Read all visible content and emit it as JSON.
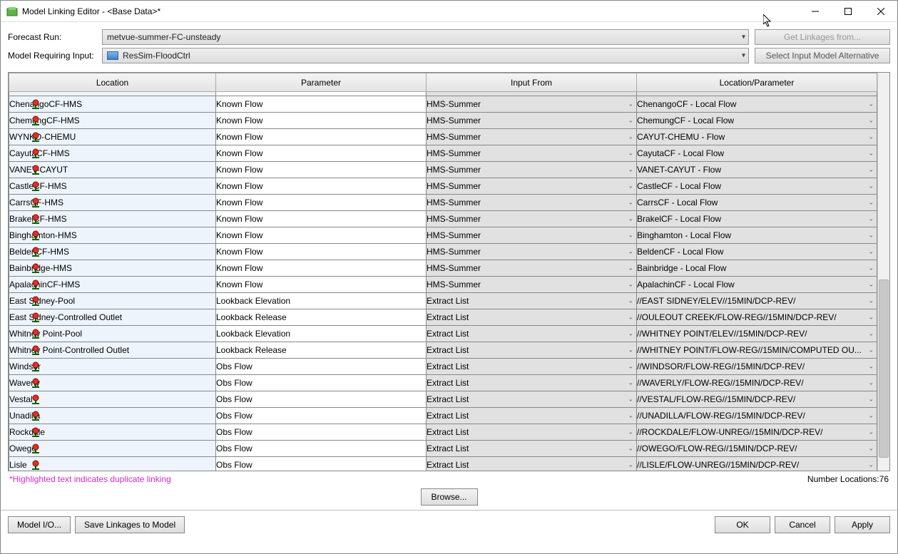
{
  "window": {
    "title": "Model Linking Editor - <Base Data>*"
  },
  "top": {
    "forecast_label": "Forecast Run:",
    "forecast_value": "metvue-summer-FC-unsteady",
    "model_req_label": "Model Requiring Input:",
    "model_req_value": "ResSim-FloodCtrl",
    "get_linkages_btn": "Get Linkages from...",
    "select_alt_btn": "Select Input Model Alternative"
  },
  "columns": {
    "c0": "Location",
    "c1": "Parameter",
    "c2": "Input From",
    "c3": "Location/Parameter"
  },
  "rows": [
    {
      "loc": "ChenangoCF-HMS",
      "param": "Known Flow",
      "input": "HMS-Summer",
      "lp": "ChenangoCF - Local Flow"
    },
    {
      "loc": "ChemungCF-HMS",
      "param": "Known Flow",
      "input": "HMS-Summer",
      "lp": "ChemungCF - Local Flow"
    },
    {
      "loc": "WYNKO-CHEMU",
      "param": "Known Flow",
      "input": "HMS-Summer",
      "lp": "CAYUT-CHEMU - Flow"
    },
    {
      "loc": "CayutaCF-HMS",
      "param": "Known Flow",
      "input": "HMS-Summer",
      "lp": "CayutaCF - Local Flow"
    },
    {
      "loc": "VANET-CAYUT",
      "param": "Known Flow",
      "input": "HMS-Summer",
      "lp": "VANET-CAYUT - Flow"
    },
    {
      "loc": "CastleCF-HMS",
      "param": "Known Flow",
      "input": "HMS-Summer",
      "lp": "CastleCF - Local Flow"
    },
    {
      "loc": "CarrsCF-HMS",
      "param": "Known Flow",
      "input": "HMS-Summer",
      "lp": "CarrsCF - Local Flow"
    },
    {
      "loc": "BrakelCF-HMS",
      "param": "Known Flow",
      "input": "HMS-Summer",
      "lp": "BrakelCF - Local Flow"
    },
    {
      "loc": "Binghamton-HMS",
      "param": "Known Flow",
      "input": "HMS-Summer",
      "lp": "Binghamton - Local Flow"
    },
    {
      "loc": "BeldenCF-HMS",
      "param": "Known Flow",
      "input": "HMS-Summer",
      "lp": "BeldenCF - Local Flow"
    },
    {
      "loc": "Bainbridge-HMS",
      "param": "Known Flow",
      "input": "HMS-Summer",
      "lp": "Bainbridge - Local Flow"
    },
    {
      "loc": "ApalachinCF-HMS",
      "param": "Known Flow",
      "input": "HMS-Summer",
      "lp": "ApalachinCF - Local Flow"
    },
    {
      "loc": "East Sidney-Pool",
      "param": "Lookback Elevation",
      "input": "Extract List",
      "lp": "//EAST SIDNEY/ELEV//15MIN/DCP-REV/"
    },
    {
      "loc": "East Sidney-Controlled Outlet",
      "param": "Lookback Release",
      "input": "Extract List",
      "lp": "//OULEOUT CREEK/FLOW-REG//15MIN/DCP-REV/"
    },
    {
      "loc": "Whitney Point-Pool",
      "param": "Lookback Elevation",
      "input": "Extract List",
      "lp": "//WHITNEY POINT/ELEV//15MIN/DCP-REV/"
    },
    {
      "loc": "Whitney Point-Controlled Outlet",
      "param": "Lookback Release",
      "input": "Extract List",
      "lp": "//WHITNEY POINT/FLOW-REG//15MIN/COMPUTED OU..."
    },
    {
      "loc": "Windsor",
      "param": "Obs Flow",
      "input": "Extract List",
      "lp": "//WINDSOR/FLOW-REG//15MIN/DCP-REV/"
    },
    {
      "loc": "Waverly",
      "param": "Obs Flow",
      "input": "Extract List",
      "lp": "//WAVERLY/FLOW-REG//15MIN/DCP-REV/"
    },
    {
      "loc": "Vestal",
      "param": "Obs Flow",
      "input": "Extract List",
      "lp": "//VESTAL/FLOW-REG//15MIN/DCP-REV/"
    },
    {
      "loc": "Unadilla",
      "param": "Obs Flow",
      "input": "Extract List",
      "lp": "//UNADILLA/FLOW-REG//15MIN/DCP-REV/"
    },
    {
      "loc": "Rockdale",
      "param": "Obs Flow",
      "input": "Extract List",
      "lp": "//ROCKDALE/FLOW-UNREG//15MIN/DCP-REV/"
    },
    {
      "loc": "Owego",
      "param": "Obs Flow",
      "input": "Extract List",
      "lp": "//OWEGO/FLOW-REG//15MIN/DCP-REV/"
    },
    {
      "loc": "Lisle",
      "param": "Obs Flow",
      "input": "Extract List",
      "lp": "//LISLE/FLOW-UNREG//15MIN/DCP-REV/"
    }
  ],
  "below": {
    "dup_note": "*Highlighted text indicates duplicate linking",
    "loc_count": "Number Locations:76",
    "browse_btn": "Browse..."
  },
  "footer": {
    "model_io": "Model I/O...",
    "save_linkages": "Save Linkages to Model",
    "ok": "OK",
    "cancel": "Cancel",
    "apply": "Apply"
  }
}
